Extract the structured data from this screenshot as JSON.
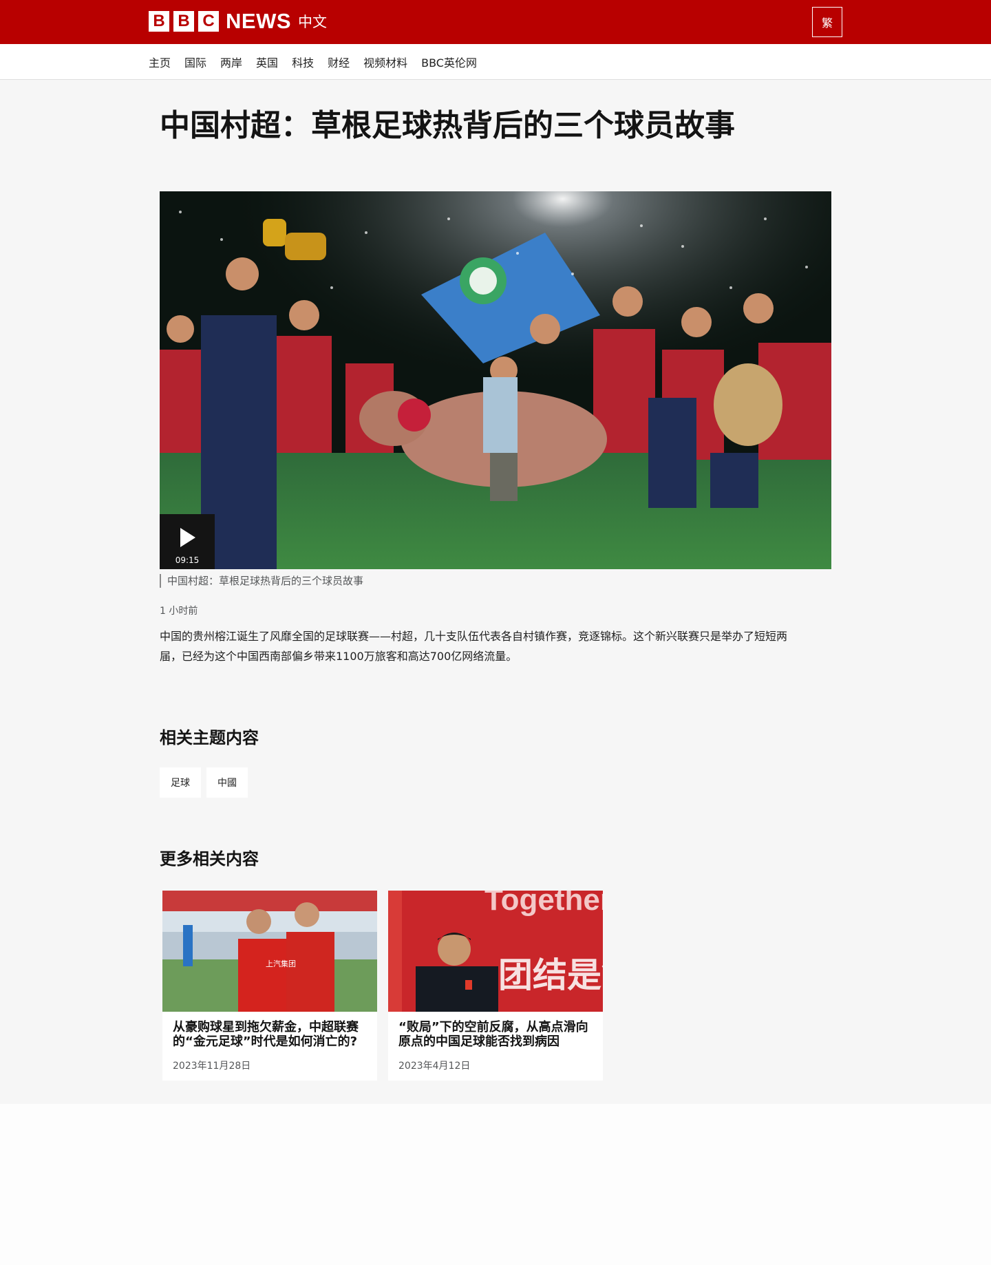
{
  "header": {
    "logo_letters": [
      "B",
      "B",
      "C"
    ],
    "logo_news": "NEWS",
    "logo_zh": "中文",
    "lang_toggle": "繁",
    "colors": {
      "brand_red": "#b80000"
    }
  },
  "nav": {
    "items": [
      {
        "label": "主页"
      },
      {
        "label": "国际"
      },
      {
        "label": "两岸"
      },
      {
        "label": "英国"
      },
      {
        "label": "科技"
      },
      {
        "label": "财经"
      },
      {
        "label": "视频材料"
      },
      {
        "label": "BBC英伦网"
      }
    ]
  },
  "article": {
    "headline": "中国村超：草根足球热背后的三个球员故事",
    "video_duration": "09:15",
    "caption": "中国村超：草根足球热背后的三个球员故事",
    "timestamp": "1 小时前",
    "summary": "中国的贵州榕江诞生了风靡全国的足球联赛——村超，几十支队伍代表各自村镇作赛，竞逐锦标。这个新兴联赛只是举办了短短两届，已经为这个中国西南部偏乡带来1100万旅客和高达700亿网络流量。"
  },
  "related_topics": {
    "title": "相关主题内容",
    "tags": [
      {
        "label": "足球"
      },
      {
        "label": "中國"
      }
    ]
  },
  "more_related": {
    "title": "更多相关内容",
    "cards": [
      {
        "title": "从豪购球星到拖欠薪金，中超联赛的“金元足球”时代是如何消亡的?",
        "date": "2023年11月28日",
        "image_text": "上汽集团"
      },
      {
        "title": "“败局”下的空前反腐，从高点滑向原点的中国足球能否找到病因",
        "date": "2023年4月12日",
        "image_text_top": "Together",
        "image_text_main": "团结是铁"
      }
    ]
  }
}
